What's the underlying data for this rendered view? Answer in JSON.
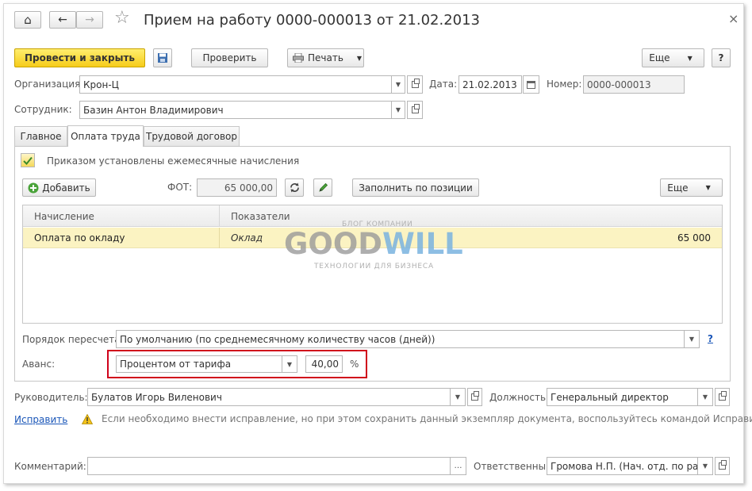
{
  "window": {
    "title": "Прием на работу 0000-000013 от 21.02.2013",
    "close_glyph": "×"
  },
  "nav": {
    "home_glyph": "⌂",
    "back_glyph": "←",
    "forward_glyph": "→",
    "star_glyph": "☆"
  },
  "toolbar": {
    "post_close": "Провести и закрыть",
    "check": "Проверить",
    "print": "Печать",
    "more": "Еще",
    "help": "?"
  },
  "header": {
    "organization_label": "Организация:",
    "organization_value": "Крон-Ц",
    "date_label": "Дата:",
    "date_value": "21.02.2013",
    "number_label": "Номер:",
    "number_value": "0000-000013",
    "employee_label": "Сотрудник:",
    "employee_value": "Базин Антон Владимирович"
  },
  "tabs": [
    {
      "label": "Главное"
    },
    {
      "label": "Оплата труда"
    },
    {
      "label": "Трудовой договор"
    }
  ],
  "pay": {
    "checkbox_label": "Приказом установлены ежемесячные начисления",
    "checkbox_checked": true,
    "add_button": "Добавить",
    "fot_label": "ФОТ:",
    "fot_value": "65 000,00",
    "fill_button": "Заполнить по позиции",
    "more_button": "Еще",
    "table": {
      "columns": [
        "Начисление",
        "Показатели"
      ],
      "rows": [
        {
          "accrual": "Оплата по окладу",
          "indicator": "Оклад",
          "value": "65 000"
        }
      ]
    },
    "recalc_label": "Порядок пересчета:",
    "recalc_value": "По умолчанию (по среднемесячному количеству часов (дней))",
    "recalc_help": "?",
    "advance_label": "Аванс:",
    "advance_mode": "Процентом от тарифа",
    "advance_value": "40,00",
    "advance_unit": "%"
  },
  "watermark": {
    "top": "БЛОГ КОМПАНИИ",
    "brand_a": "GOOD",
    "brand_b": "WILL",
    "bottom": "ТЕХНОЛОГИИ ДЛЯ БИЗНЕСА"
  },
  "footer": {
    "manager_label": "Руководитель:",
    "manager_value": "Булатов Игорь Виленович",
    "position_label": "Должность:",
    "position_value": "Генеральный директор",
    "correct_link": "Исправить",
    "warning_text": "Если необходимо внести исправление, но при этом сохранить данный экземпляр документа, воспользуйтесь командой Исправить",
    "comment_label": "Комментарий:",
    "comment_value": "",
    "responsible_label": "Ответственный:",
    "responsible_value": "Громова Н.П. (Нач. отд. по работе"
  },
  "colors": {
    "accent_yellow": "#f6cc1a",
    "selected_row": "#fbf3c2",
    "highlight_border": "#d0021b",
    "link": "#1a56b8",
    "watermark_gray": "#9a9a9a",
    "watermark_blue": "#7ab3e0"
  }
}
